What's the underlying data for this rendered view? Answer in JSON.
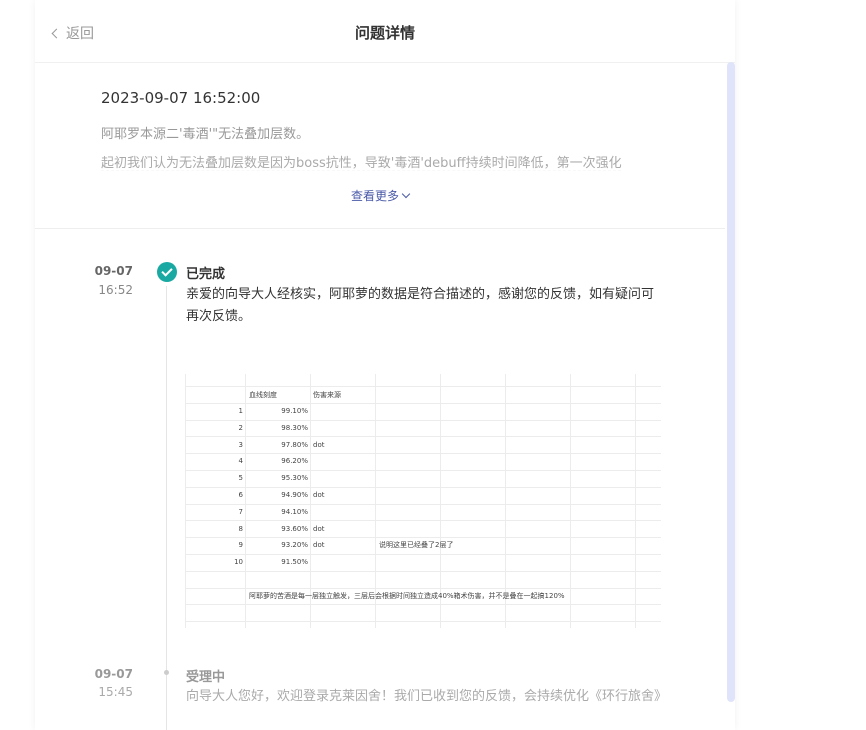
{
  "header": {
    "back_label": "返回",
    "title": "问题详情"
  },
  "question": {
    "datetime": "2023-09-07 16:52:00",
    "line1": "阿耶罗本源二'毒酒'\"无法叠加层数。",
    "line2": "起初我们认为无法叠加层数是因为boss抗性，导致'毒酒'debuff持续时间降低，第一次强化",
    "more_label": "查看更多"
  },
  "timeline": [
    {
      "date": "09-07",
      "time": "16:52",
      "status": "已完成",
      "text": "亲爱的向导大人经核实，阿耶萝的数据是符合描述的，感谢您的反馈，如有疑问可再次反馈。"
    },
    {
      "date": "09-07",
      "time": "15:45",
      "status": "受理中",
      "text": "向导大人您好，欢迎登录克莱因舍！我们已收到您的反馈，会持续优化《环行旅舍》"
    }
  ],
  "spreadsheet": {
    "headers": [
      "血线刻度",
      "伤害来源"
    ],
    "rows": [
      {
        "n": "1",
        "pct": "99.10%",
        "src": "",
        "note": ""
      },
      {
        "n": "2",
        "pct": "98.30%",
        "src": "",
        "note": ""
      },
      {
        "n": "3",
        "pct": "97.80%",
        "src": "dot",
        "note": ""
      },
      {
        "n": "4",
        "pct": "96.20%",
        "src": "",
        "note": ""
      },
      {
        "n": "5",
        "pct": "95.30%",
        "src": "",
        "note": ""
      },
      {
        "n": "6",
        "pct": "94.90%",
        "src": "dot",
        "note": ""
      },
      {
        "n": "7",
        "pct": "94.10%",
        "src": "",
        "note": ""
      },
      {
        "n": "8",
        "pct": "93.60%",
        "src": "dot",
        "note": ""
      },
      {
        "n": "9",
        "pct": "93.20%",
        "src": "dot",
        "note": "说明这里已经叠了2层了"
      },
      {
        "n": "10",
        "pct": "91.50%",
        "src": "",
        "note": ""
      }
    ],
    "footer_note": "阿耶萝的苦酒是每一层独立触发，三层后会根据时间独立造成40%箱术伤害，并不是叠在一起搞120%"
  },
  "colors": {
    "completed": "#1aa9a2",
    "link": "#4a5aa8",
    "scrollbar": "#dfe4fa"
  }
}
